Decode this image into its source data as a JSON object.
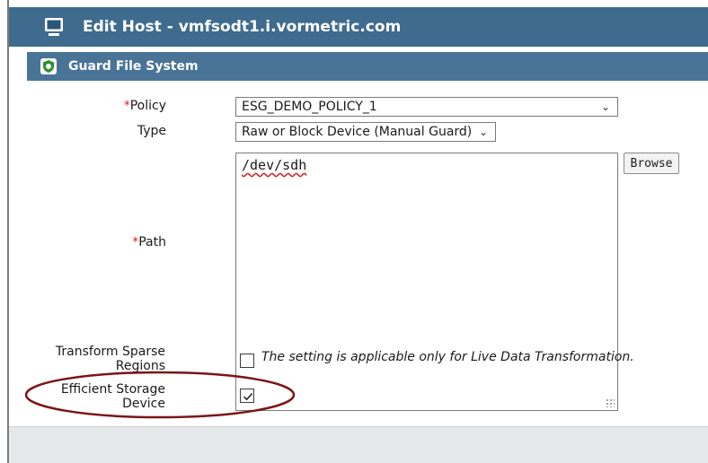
{
  "window": {
    "title": "Edit Host - vmfsodt1.i.vormetric.com"
  },
  "section": {
    "title": "Guard File System"
  },
  "form": {
    "policy": {
      "required_marker": "*",
      "label": "Policy",
      "value": "ESG_DEMO_POLICY_1"
    },
    "type": {
      "label": "Type",
      "value": "Raw or Block Device (Manual Guard)"
    },
    "path": {
      "required_marker": "*",
      "label": "Path",
      "value": "/dev/sdh",
      "browse_label": "Browse"
    },
    "transform_sparse": {
      "label_line1": "Transform Sparse",
      "label_line2": "Regions",
      "checked": false,
      "note": "The setting is applicable only for Live Data Transformation."
    },
    "efficient_storage": {
      "label_line1": "Efficient Storage",
      "label_line2": "Device",
      "checked": true
    }
  },
  "colors": {
    "title_bar": "#3f6b8e",
    "section_bar": "#4a7497",
    "required": "#e02020",
    "highlight_ellipse": "#7a1515"
  },
  "icons": {
    "window_icon": "monitor-icon",
    "section_icon": "shield-icon",
    "chevron": "chevron-down-icon"
  }
}
